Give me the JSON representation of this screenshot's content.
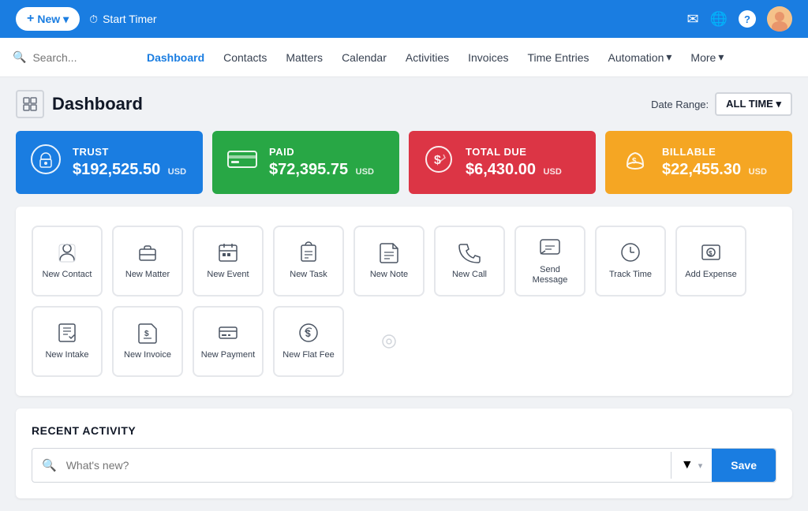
{
  "topBar": {
    "newButton": "+ New ▾",
    "newLabel": "New",
    "startTimerLabel": "Start Timer",
    "icons": [
      "✉",
      "🌐",
      "?"
    ]
  },
  "nav": {
    "searchPlaceholder": "Search...",
    "links": [
      {
        "label": "Dashboard",
        "active": true
      },
      {
        "label": "Contacts",
        "active": false
      },
      {
        "label": "Matters",
        "active": false
      },
      {
        "label": "Calendar",
        "active": false
      },
      {
        "label": "Activities",
        "active": false
      },
      {
        "label": "Invoices",
        "active": false
      },
      {
        "label": "Time Entries",
        "active": false
      },
      {
        "label": "Automation ▾",
        "active": false
      },
      {
        "label": "More ▾",
        "active": false
      }
    ]
  },
  "pageHeader": {
    "title": "Dashboard",
    "dateRangeLabel": "Date Range:",
    "dateRangeValue": "ALL TIME ▾"
  },
  "statCards": [
    {
      "id": "trust",
      "label": "TRUST",
      "value": "$192,525.50",
      "currency": "USD",
      "icon": "🏦"
    },
    {
      "id": "paid",
      "label": "PAID",
      "value": "$72,395.75",
      "currency": "USD",
      "icon": "💵"
    },
    {
      "id": "total-due",
      "label": "TOTAL DUE",
      "value": "$6,430.00",
      "currency": "USD",
      "icon": "💰"
    },
    {
      "id": "billable",
      "label": "BILLABLE",
      "value": "$22,455.30",
      "currency": "USD",
      "icon": "💼"
    }
  ],
  "quickActions": [
    {
      "id": "new-contact",
      "label": "New Contact",
      "icon": "person"
    },
    {
      "id": "new-matter",
      "label": "New Matter",
      "icon": "briefcase"
    },
    {
      "id": "new-event",
      "label": "New Event",
      "icon": "calendar"
    },
    {
      "id": "new-task",
      "label": "New Task",
      "icon": "clipboard"
    },
    {
      "id": "new-note",
      "label": "New Note",
      "icon": "note"
    },
    {
      "id": "new-call",
      "label": "New Call",
      "icon": "phone"
    },
    {
      "id": "send-message",
      "label": "Send Message",
      "icon": "message"
    },
    {
      "id": "track-time",
      "label": "Track Time",
      "icon": "clock"
    },
    {
      "id": "add-expense",
      "label": "Add Expense",
      "icon": "expense"
    },
    {
      "id": "new-intake",
      "label": "New Intake",
      "icon": "intake"
    },
    {
      "id": "new-invoice",
      "label": "New Invoice",
      "icon": "invoice"
    },
    {
      "id": "new-payment",
      "label": "New Payment",
      "icon": "payment"
    },
    {
      "id": "new-flat-fee",
      "label": "New Flat Fee",
      "icon": "flatfee"
    }
  ],
  "recentActivity": {
    "title": "RECENT ACTIVITY",
    "searchPlaceholder": "What's new?",
    "saveLabel": "Save"
  }
}
